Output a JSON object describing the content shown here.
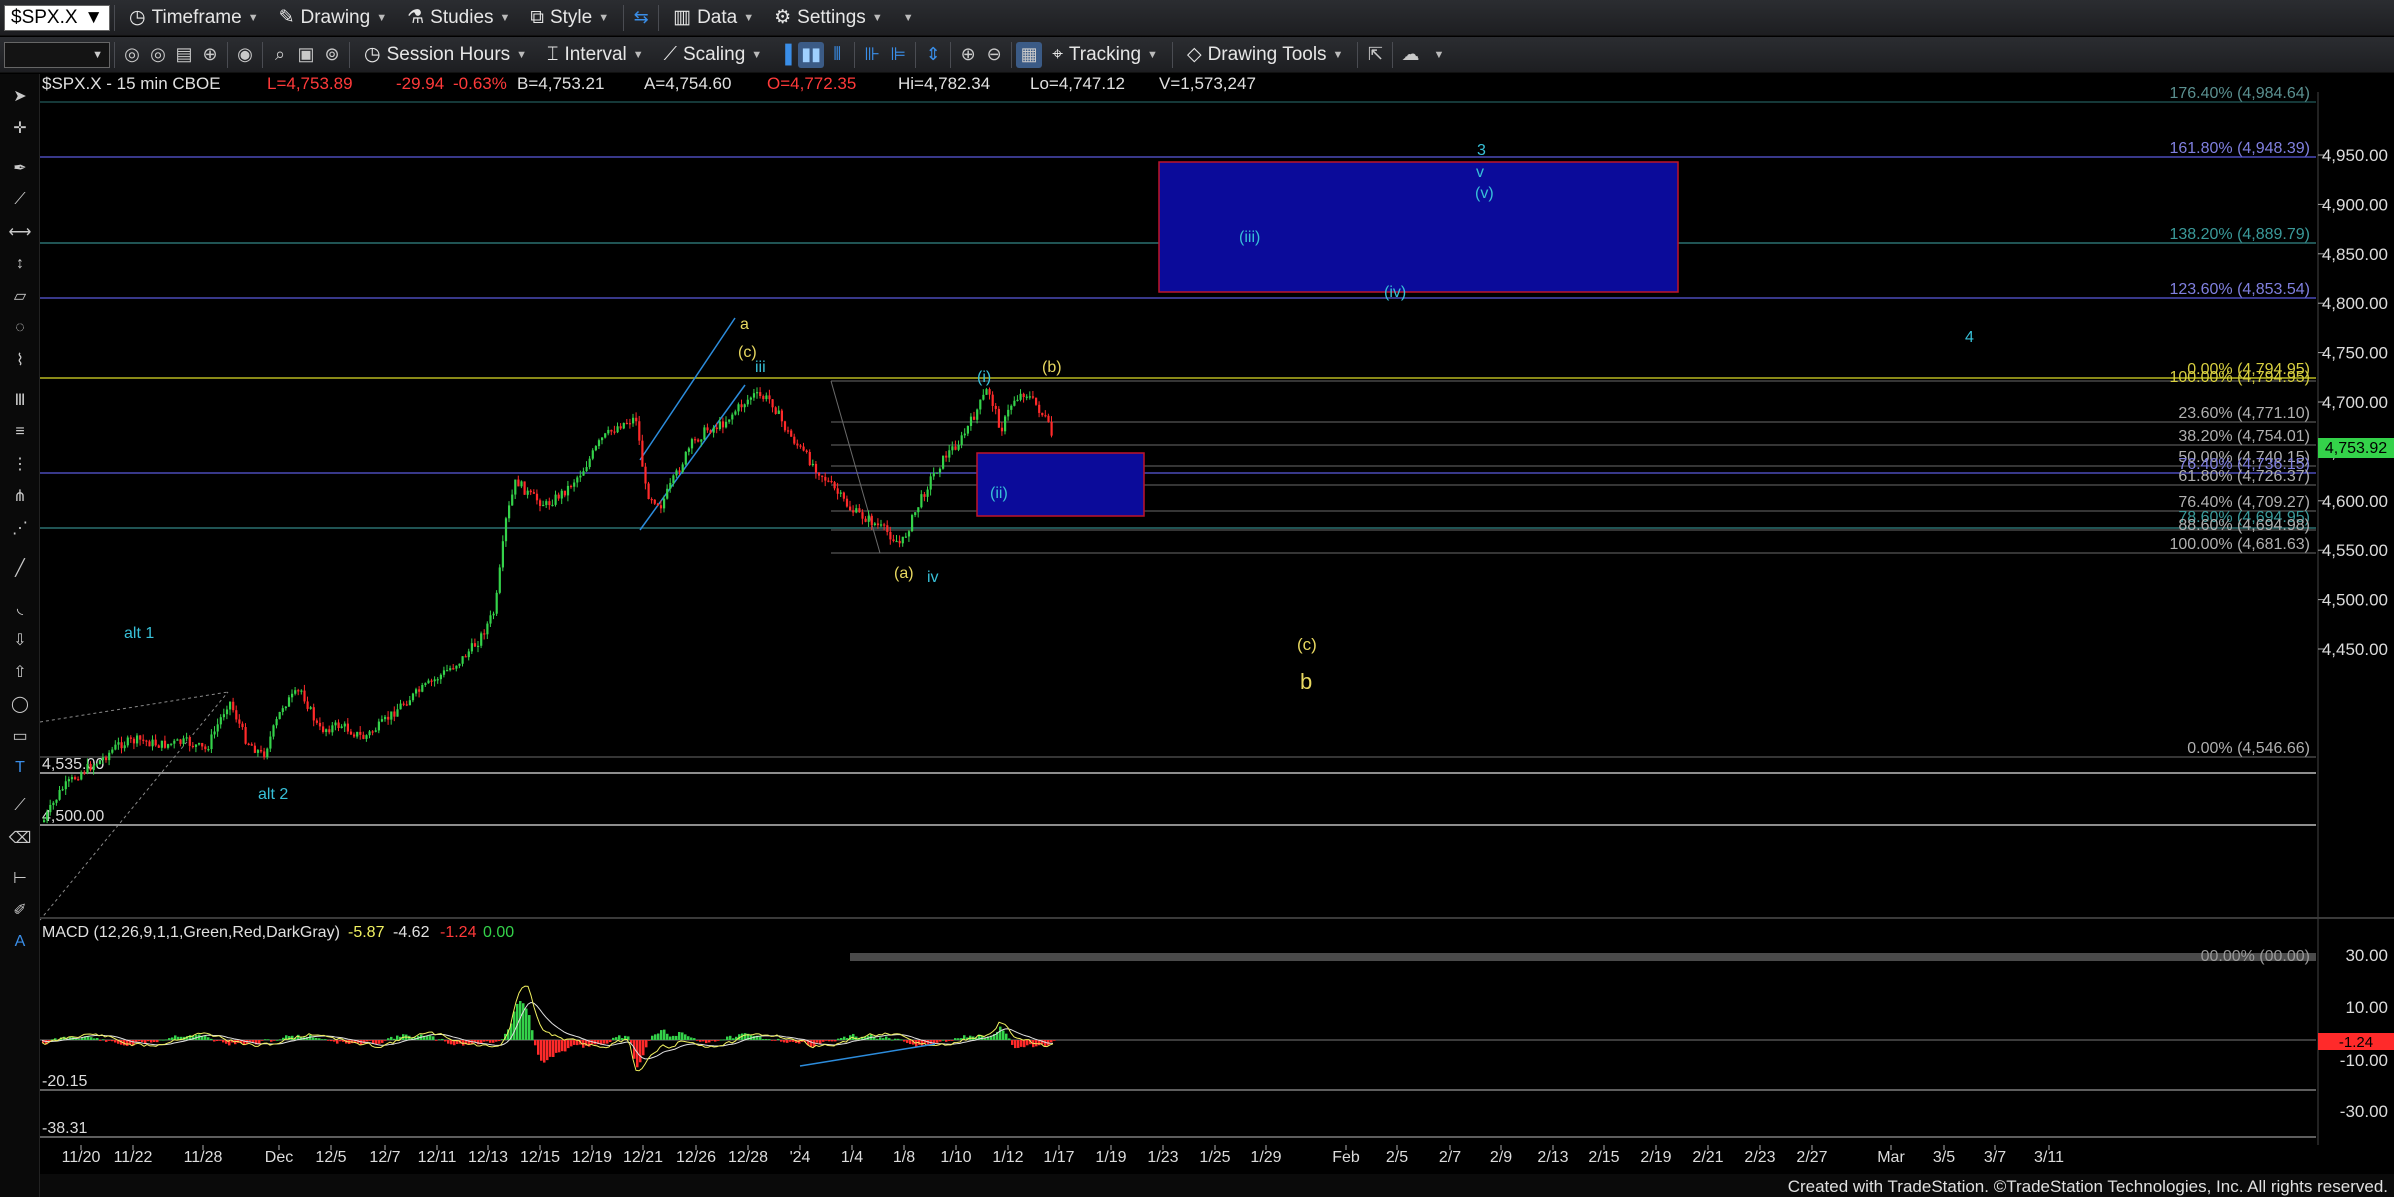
{
  "toolbar1": {
    "symbol": "$SPX.X",
    "timeframe": "Timeframe",
    "drawing": "Drawing",
    "studies": "Studies",
    "style": "Style",
    "data": "Data",
    "settings": "Settings"
  },
  "toolbar2": {
    "session_hours": "Session Hours",
    "interval": "Interval",
    "scaling": "Scaling",
    "tracking": "Tracking",
    "drawing_tools": "Drawing Tools"
  },
  "quote_bar": {
    "symbol_desc": "$SPX.X - 15 min  CBOE",
    "last": "L=4,753.89",
    "change": "-29.94",
    "change_pct": "-0.63%",
    "bid": "B=4,753.21",
    "ask": "A=4,754.60",
    "open": "O=4,772.35",
    "high": "Hi=4,782.34",
    "low": "Lo=4,747.12",
    "volume": "V=1,573,247"
  },
  "macd": {
    "label": "MACD (12,26,9,1,1,Green,Red,DarkGray)",
    "v1": "-5.87",
    "v2": "-4.62",
    "v3": "-1.24",
    "v4": "0.00",
    "current_badge": "-1.24",
    "left_high": "-20.15",
    "left_low": "-38.31",
    "axis_ticks": [
      "30.00",
      "10.00",
      "-10.00",
      "-30.00"
    ],
    "overlap_text": "00.00% (00.00)"
  },
  "price_axis": {
    "ticks": [
      "4,950.00",
      "4,900.00",
      "4,850.00",
      "4,800.00",
      "4,750.00",
      "4,700.00",
      "4,650.00",
      "4,600.00",
      "4,550.00",
      "4,500.00",
      "4,450.00"
    ],
    "last_price": "4,753.92"
  },
  "x_axis": {
    "labels": [
      "11/20",
      "11/22",
      "11/28",
      "Dec",
      "12/5",
      "12/7",
      "12/11",
      "12/13",
      "12/15",
      "12/19",
      "12/21",
      "12/26",
      "12/28",
      "'24",
      "1/4",
      "1/8",
      "1/10",
      "1/12",
      "1/17",
      "1/19",
      "1/23",
      "1/25",
      "1/29",
      "Feb",
      "2/5",
      "2/7",
      "2/9",
      "2/13",
      "2/15",
      "2/19",
      "2/21",
      "2/23",
      "2/27",
      "Mar",
      "3/5",
      "3/7",
      "3/11"
    ]
  },
  "fib_labels": {
    "ext_176": "176.40% (4,984.64)",
    "ext_161": "161.80% (4,948.39)",
    "ext_138": "138.20% (4,889.79)",
    "ext_123": "123.60% (4,853.54)",
    "r0_top": "0.00% (4,794.95)",
    "r100_top": "100.00% (4,794.95)",
    "r236": "23.60% (4,771.10)",
    "r382": "38.20% (4,754.01)",
    "r50": "50.00% (4,740.15)",
    "r764a": "76.40% (4,736.15)",
    "r618": "61.80% (4,726.37)",
    "r764": "76.40% (4,709.27)",
    "r786": "78.60% (4,694.95)",
    "r886": "88.60% (4,694.98)",
    "r100": "100.00% (4,681.63)",
    "r0_bottom": "0.00% (4,546.66)"
  },
  "left_labels": {
    "l4535": "4,535.00",
    "l4500": "4,500.00"
  },
  "wave_labels": {
    "alt1": "alt 1",
    "alt2": "alt 2",
    "a": "a",
    "c_paren": "(c)",
    "iii": "iii",
    "a_paren": "(a)",
    "iv": "iv",
    "i_paren": "(i)",
    "b_paren": "(b)",
    "ii_paren": "(ii)",
    "iii_paren": "(iii)",
    "iv_paren": "(iv)",
    "v_paren": "(v)",
    "v": "v",
    "three": "3",
    "four": "4",
    "c_paren_lower": "(c)",
    "b": "b"
  },
  "footer": "Created with TradeStation. ©TradeStation Technologies, Inc. All rights reserved.",
  "colors": {
    "up": "#34d24a",
    "down": "#ff2a2a",
    "macd_line": "#f0f060",
    "signal_line": "#e0e0e0",
    "fib_blue": "#5a5ac8",
    "fib_teal": "#2a8080",
    "fib_yellow": "#b8b820",
    "wave_yellow": "#e8d860",
    "wave_cyan": "#38c0d8",
    "box_fill": "#0b0b9a",
    "box_border": "#c0142a"
  }
}
